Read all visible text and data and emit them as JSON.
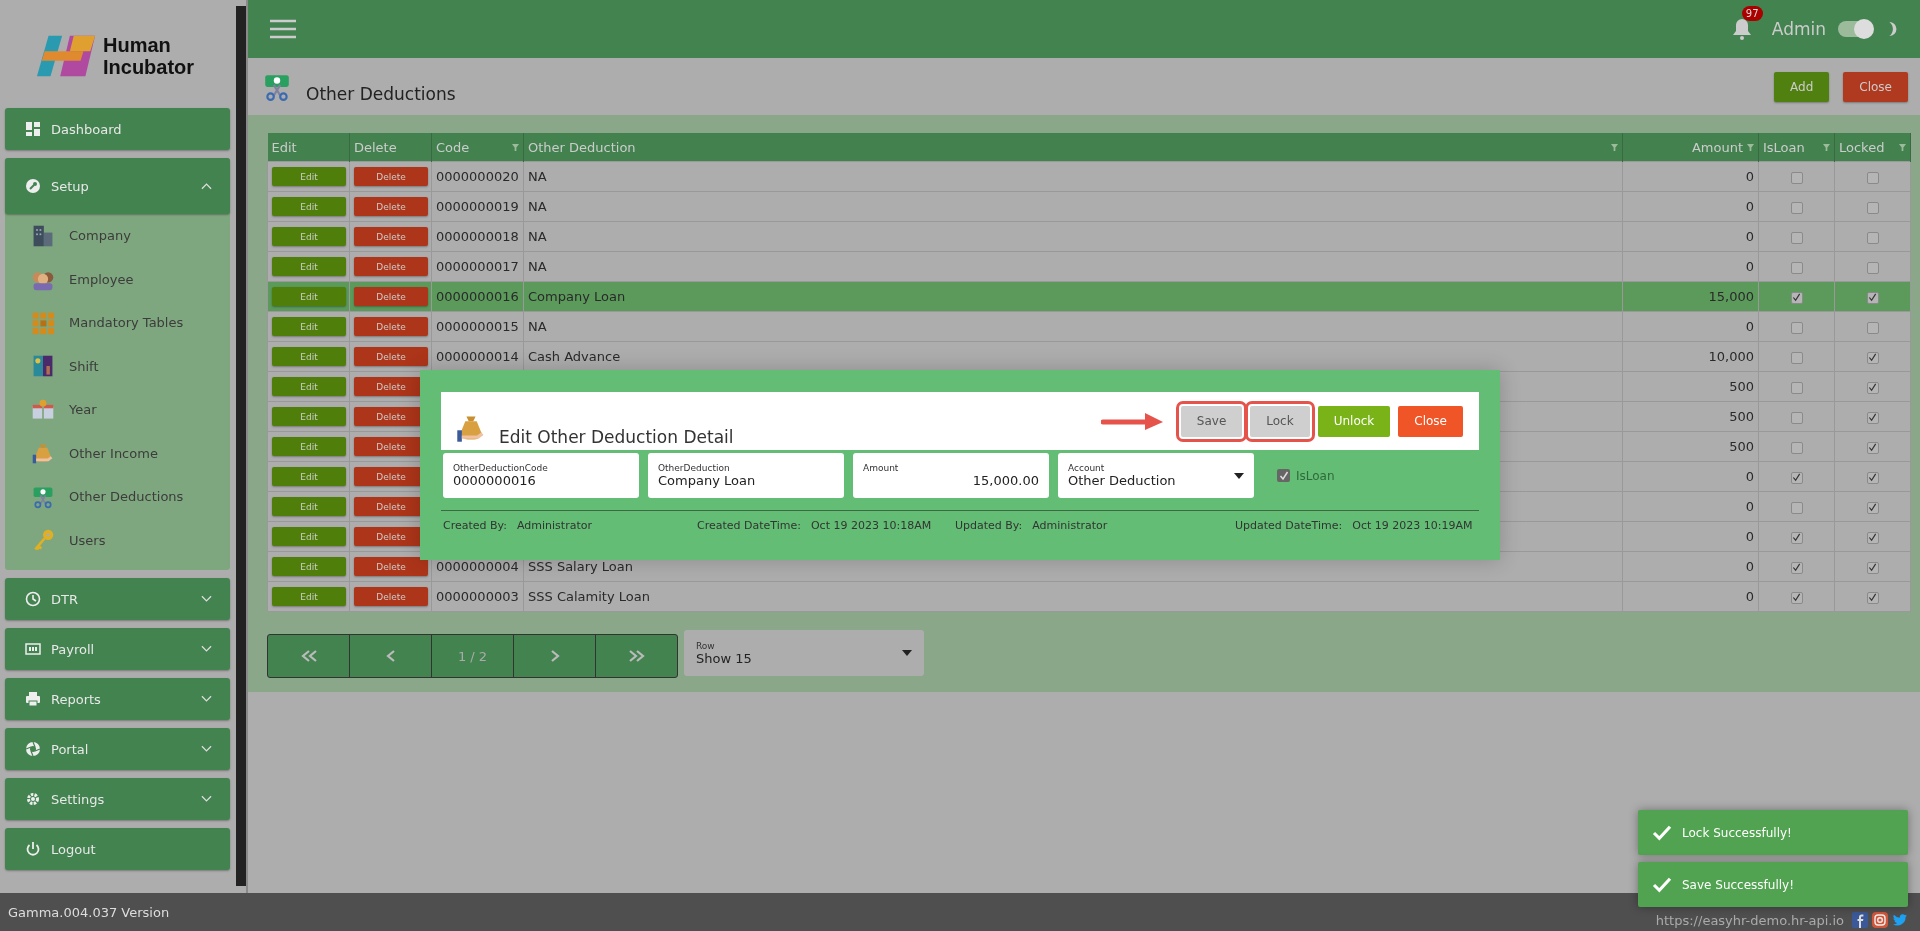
{
  "sidebar": {
    "brand": "Human Incubator",
    "menu": [
      {
        "label": "Dashboard",
        "kind": "link"
      },
      {
        "label": "Setup",
        "kind": "group",
        "expanded": true,
        "children": [
          {
            "label": "Company"
          },
          {
            "label": "Employee"
          },
          {
            "label": "Mandatory Tables"
          },
          {
            "label": "Shift"
          },
          {
            "label": "Year"
          },
          {
            "label": "Other Income"
          },
          {
            "label": "Other Deductions"
          },
          {
            "label": "Users"
          }
        ]
      },
      {
        "label": "DTR",
        "kind": "group",
        "expanded": false
      },
      {
        "label": "Payroll",
        "kind": "group",
        "expanded": false
      },
      {
        "label": "Reports",
        "kind": "group",
        "expanded": false
      },
      {
        "label": "Portal",
        "kind": "group",
        "expanded": false
      },
      {
        "label": "Settings",
        "kind": "group",
        "expanded": false
      },
      {
        "label": "Logout",
        "kind": "link"
      }
    ]
  },
  "header": {
    "notification_count": "97",
    "user": "Admin",
    "dark_mode": {
      "on": true
    }
  },
  "page": {
    "title": "Other Deductions",
    "buttons": [
      {
        "label": "Add",
        "kind": "success"
      },
      {
        "label": "Close",
        "kind": "danger"
      }
    ]
  },
  "table": {
    "columns": [
      {
        "label": "Edit",
        "filter": false
      },
      {
        "label": "Delete",
        "filter": false
      },
      {
        "label": "Code",
        "filter": true
      },
      {
        "label": "Other Deduction",
        "filter": true
      },
      {
        "label": "Amount",
        "filter": true
      },
      {
        "label": "IsLoan",
        "filter": true
      },
      {
        "label": "Locked",
        "filter": true
      }
    ],
    "rows": [
      {
        "edit": "Edit",
        "delete": "Delete",
        "code": "0000000020",
        "name": "NA",
        "amount": "0",
        "is_loan": false,
        "locked": false,
        "selected": false
      },
      {
        "edit": "Edit",
        "delete": "Delete",
        "code": "0000000019",
        "name": "NA",
        "amount": "0",
        "is_loan": false,
        "locked": false,
        "selected": false
      },
      {
        "edit": "Edit",
        "delete": "Delete",
        "code": "0000000018",
        "name": "NA",
        "amount": "0",
        "is_loan": false,
        "locked": false,
        "selected": false
      },
      {
        "edit": "Edit",
        "delete": "Delete",
        "code": "0000000017",
        "name": "NA",
        "amount": "0",
        "is_loan": false,
        "locked": false,
        "selected": false
      },
      {
        "edit": "Edit",
        "delete": "Delete",
        "code": "0000000016",
        "name": "Company Loan",
        "amount": "15,000",
        "is_loan": true,
        "locked": true,
        "selected": true
      },
      {
        "edit": "Edit",
        "delete": "Delete",
        "code": "0000000015",
        "name": "NA",
        "amount": "0",
        "is_loan": false,
        "locked": false,
        "selected": false
      },
      {
        "edit": "Edit",
        "delete": "Delete",
        "code": "0000000014",
        "name": "Cash Advance",
        "amount": "10,000",
        "is_loan": false,
        "locked": true,
        "selected": false
      },
      {
        "edit": "Edit",
        "delete": "Delete",
        "amount": "500",
        "is_loan": false,
        "locked": true,
        "selected": false
      },
      {
        "edit": "Edit",
        "delete": "Delete",
        "amount": "500",
        "is_loan": false,
        "locked": true,
        "selected": false
      },
      {
        "edit": "Edit",
        "delete": "Delete",
        "amount": "500",
        "is_loan": false,
        "locked": true,
        "selected": false
      },
      {
        "edit": "Edit",
        "delete": "Delete",
        "amount": "0",
        "is_loan": true,
        "locked": true,
        "selected": false
      },
      {
        "edit": "Edit",
        "delete": "Delete",
        "amount": "0",
        "is_loan": false,
        "locked": true,
        "selected": false
      },
      {
        "edit": "Edit",
        "delete": "Delete",
        "amount": "0",
        "is_loan": true,
        "locked": true,
        "selected": false
      },
      {
        "edit": "Edit",
        "delete": "Delete",
        "code": "0000000004",
        "name": "SSS Salary Loan",
        "amount": "0",
        "is_loan": true,
        "locked": true,
        "selected": false
      },
      {
        "edit": "Edit",
        "delete": "Delete",
        "code": "0000000003",
        "name": "SSS Calamity Loan",
        "amount": "0",
        "is_loan": true,
        "locked": true,
        "selected": false
      }
    ]
  },
  "pagination": {
    "page": "1 / 2",
    "rows": {
      "label": "Row",
      "value": "Show 15"
    }
  },
  "modal": {
    "title": "Edit Other Deduction Detail",
    "buttons": [
      {
        "label": "Save",
        "kind": "default",
        "disabled": true,
        "highlighted": true
      },
      {
        "label": "Lock",
        "kind": "default",
        "disabled": true,
        "highlighted": true
      },
      {
        "label": "Unlock",
        "kind": "success",
        "disabled": false,
        "highlighted": false
      },
      {
        "label": "Close",
        "kind": "danger",
        "disabled": false,
        "highlighted": false
      }
    ],
    "fields": [
      {
        "label": "OtherDeductionCode",
        "value": "0000000016",
        "kind": "text"
      },
      {
        "label": "OtherDeduction",
        "value": "Company Loan",
        "kind": "text"
      },
      {
        "label": "Amount",
        "value": "15,000.00",
        "kind": "number"
      },
      {
        "label": "Account",
        "value": "Other Deduction",
        "kind": "select"
      }
    ],
    "is_loan": {
      "label": "IsLoan",
      "checked": true,
      "disabled": true
    },
    "meta": [
      {
        "label": "Created By:",
        "value": "Administrator"
      },
      {
        "label": "Created DateTime:",
        "value": "Oct 19 2023 10:18AM"
      },
      {
        "label": "Updated By:",
        "value": "Administrator"
      },
      {
        "label": "Updated DateTime:",
        "value": "Oct 19 2023 10:19AM"
      }
    ]
  },
  "footer": {
    "version": "Gamma.004.037 Version",
    "url": "https://easyhr-demo.hr-api.io"
  },
  "toasts": [
    {
      "message": "Lock Successfully!"
    },
    {
      "message": "Save Successfully!"
    }
  ]
}
